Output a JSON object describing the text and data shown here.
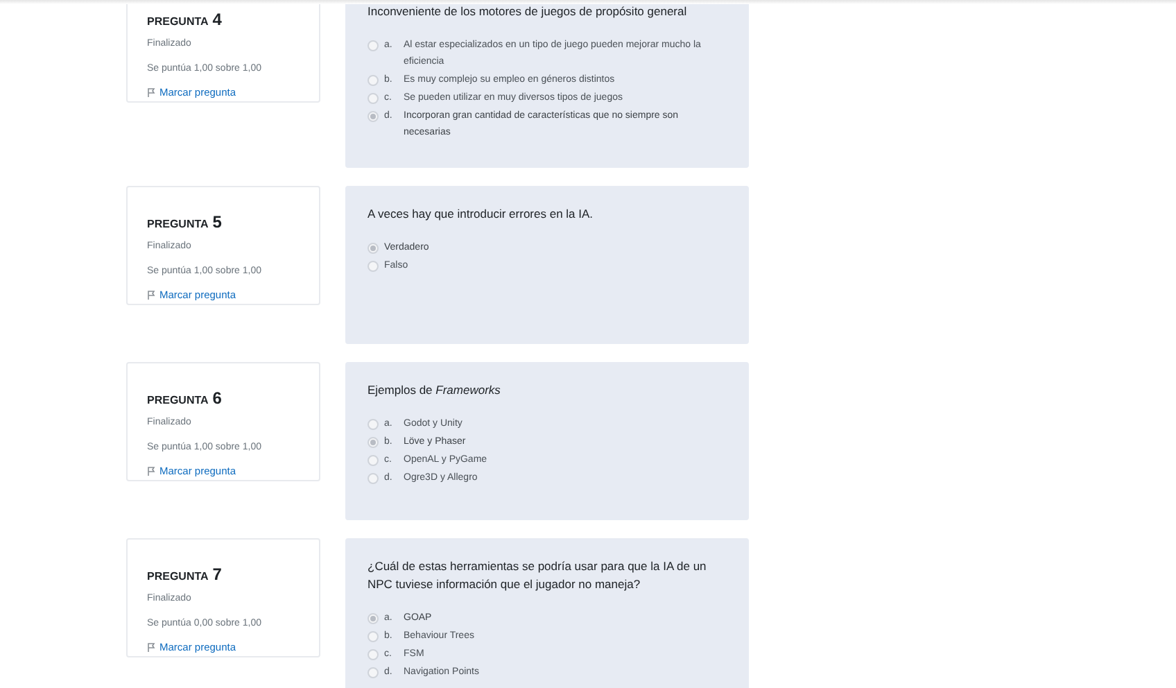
{
  "questions": [
    {
      "label": "PREGUNTA",
      "number": "4",
      "status": "Finalizado",
      "score": "Se puntúa 1,00 sobre 1,00",
      "flag": "Marcar pregunta",
      "text": "Inconveniente de los motores de juegos de propósito general",
      "options": [
        {
          "letter": "a.",
          "text": "Al estar especializados en un tipo de juego pueden mejorar mucho la eficiencia",
          "selected": false
        },
        {
          "letter": "b.",
          "text": "Es muy complejo su empleo en géneros distintos",
          "selected": false
        },
        {
          "letter": "c.",
          "text": "Se pueden utilizar en muy diversos tipos de juegos",
          "selected": false
        },
        {
          "letter": "d.",
          "text": "Incorporan gran cantidad de características que no siempre son necesarias",
          "selected": true
        }
      ]
    },
    {
      "label": "PREGUNTA",
      "number": "5",
      "status": "Finalizado",
      "score": "Se puntúa 1,00 sobre 1,00",
      "flag": "Marcar pregunta",
      "text": "A veces hay que introducir errores en la IA.",
      "options": [
        {
          "text": "Verdadero",
          "selected": true
        },
        {
          "text": "Falso",
          "selected": false
        }
      ]
    },
    {
      "label": "PREGUNTA",
      "number": "6",
      "status": "Finalizado",
      "score": "Se puntúa 1,00 sobre 1,00",
      "flag": "Marcar pregunta",
      "text": "Ejemplos de *Frameworks*",
      "options": [
        {
          "letter": "a.",
          "text": "Godot y Unity",
          "selected": false
        },
        {
          "letter": "b.",
          "text": "Löve y Phaser",
          "selected": true
        },
        {
          "letter": "c.",
          "text": "OpenAL y PyGame",
          "selected": false
        },
        {
          "letter": "d.",
          "text": "Ogre3D y Allegro",
          "selected": false
        }
      ]
    },
    {
      "label": "PREGUNTA",
      "number": "7",
      "status": "Finalizado",
      "score": "Se puntúa 0,00 sobre 1,00",
      "flag": "Marcar pregunta",
      "text": "¿Cuál de estas herramientas se podría usar para que la IA de un NPC tuviese información que el jugador no maneja?",
      "options": [
        {
          "letter": "a.",
          "text": "GOAP",
          "selected": true
        },
        {
          "letter": "b.",
          "text": "Behaviour Trees",
          "selected": false
        },
        {
          "letter": "c.",
          "text": "FSM",
          "selected": false
        },
        {
          "letter": "d.",
          "text": "Navigation Points",
          "selected": false
        }
      ]
    }
  ]
}
